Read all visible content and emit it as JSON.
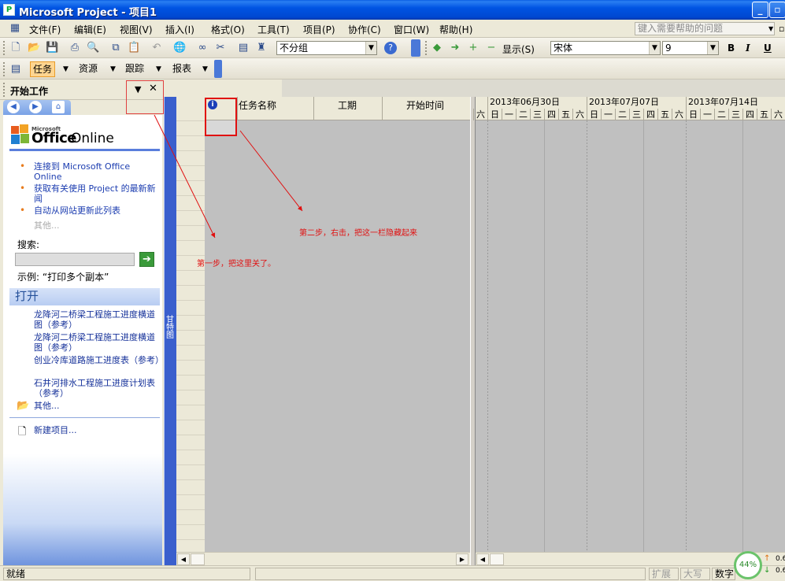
{
  "window": {
    "title": "Microsoft Project - 项目1"
  },
  "menu": {
    "items": [
      "文件(F)",
      "编辑(E)",
      "视图(V)",
      "插入(I)",
      "格式(O)",
      "工具(T)",
      "项目(P)",
      "协作(C)",
      "窗口(W)",
      "帮助(H)"
    ],
    "help_placeholder": "键入需要帮助的问题"
  },
  "toolbar1": {
    "group_combo": "不分组",
    "display_label": "显示(S)",
    "font_combo": "宋体",
    "size_combo": "9",
    "bold": "B",
    "italic": "I",
    "underline": "U"
  },
  "toolbar2": {
    "task": "任务",
    "resource": "资源",
    "track": "跟踪",
    "report": "报表"
  },
  "task_pane": {
    "title": "开始工作",
    "logo_small": "Microsoft",
    "logo_office": "Office",
    "logo_online": "Online",
    "links": [
      "连接到 Microsoft Office Online",
      "获取有关使用 Project 的最新新闻",
      "自动从网站更新此列表"
    ],
    "more": "其他...",
    "search_label": "搜索:",
    "example": "示例: “打印多个副本”",
    "open_header": "打开",
    "open_files": [
      "龙降河二桥梁工程施工进度横道图（参考）",
      "龙降河二桥梁工程施工进度横道图（参考）",
      "创业冷库道路施工进度表（参考）",
      "石井河排水工程施工进度计划表（参考）"
    ],
    "open_more": "其他...",
    "new_project": "新建项目..."
  },
  "side_bar_label": "甘特图",
  "table": {
    "columns": [
      "任务名称",
      "工期",
      "开始时间"
    ]
  },
  "gantt": {
    "weeks": [
      "2013年06月30日",
      "2013年07月07日",
      "2013年07月14日"
    ],
    "days": [
      "六",
      "日",
      "一",
      "二",
      "三",
      "四",
      "五",
      "六",
      "日",
      "一",
      "二",
      "三",
      "四",
      "五",
      "六",
      "日",
      "一",
      "二",
      "三",
      "四",
      "五",
      "六"
    ]
  },
  "annotations": {
    "step1": "第一步，把这里关了。",
    "step2": "第二步，右击，把这一栏隐藏起来"
  },
  "status": {
    "ready": "就绪",
    "ext": "扩展",
    "caps": "大写",
    "num": "数字",
    "percent": "44%",
    "net_up": "0.6",
    "net_down": "0.6"
  }
}
